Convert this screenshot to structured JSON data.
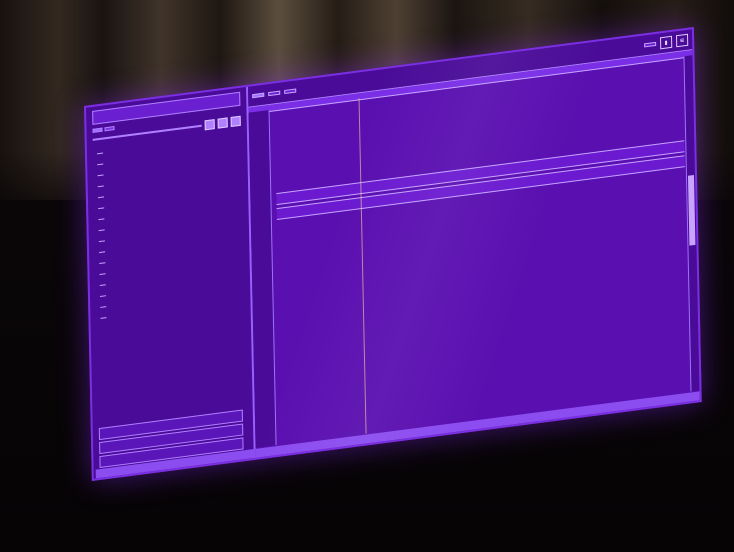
{
  "left_panel": {
    "header": "",
    "tabs": [
      "",
      ""
    ],
    "toolbar_label": "",
    "tree_items": [
      {
        "label": "",
        "num": ""
      },
      {
        "label": "",
        "num": ""
      },
      {
        "label": "",
        "num": ""
      },
      {
        "label": "",
        "num": ""
      },
      {
        "label": "",
        "num": ""
      },
      {
        "label": "",
        "num": ""
      },
      {
        "label": "",
        "num": ""
      },
      {
        "label": "",
        "num": ""
      },
      {
        "label": "",
        "num": ""
      },
      {
        "label": "",
        "num": ""
      },
      {
        "label": "",
        "num": ""
      },
      {
        "label": "",
        "num": ""
      },
      {
        "label": "",
        "num": ""
      },
      {
        "label": "",
        "num": ""
      },
      {
        "label": "",
        "num": ""
      },
      {
        "label": "",
        "num": ""
      }
    ],
    "bottom_rows": [
      "",
      "",
      ""
    ],
    "status": ""
  },
  "editor": {
    "tabs": [
      "",
      "",
      "",
      ""
    ],
    "gutter": [
      "",
      "",
      "",
      "",
      "",
      "",
      "",
      "",
      "",
      "",
      "",
      "",
      "",
      "",
      "",
      "",
      "",
      "",
      "",
      "",
      "",
      "",
      "",
      "",
      ""
    ],
    "code_lines": [
      "",
      "",
      "",
      "",
      "",
      "",
      "",
      "",
      ""
    ],
    "separator_1": "",
    "separator_2": "",
    "code_lines_2": [
      "",
      "",
      "",
      "",
      "",
      "",
      "",
      "",
      ""
    ],
    "status": [
      "",
      ""
    ]
  },
  "colors": {
    "screen": "#5a0fb0",
    "panel": "#4a0c98",
    "accent": "#b080ff"
  }
}
